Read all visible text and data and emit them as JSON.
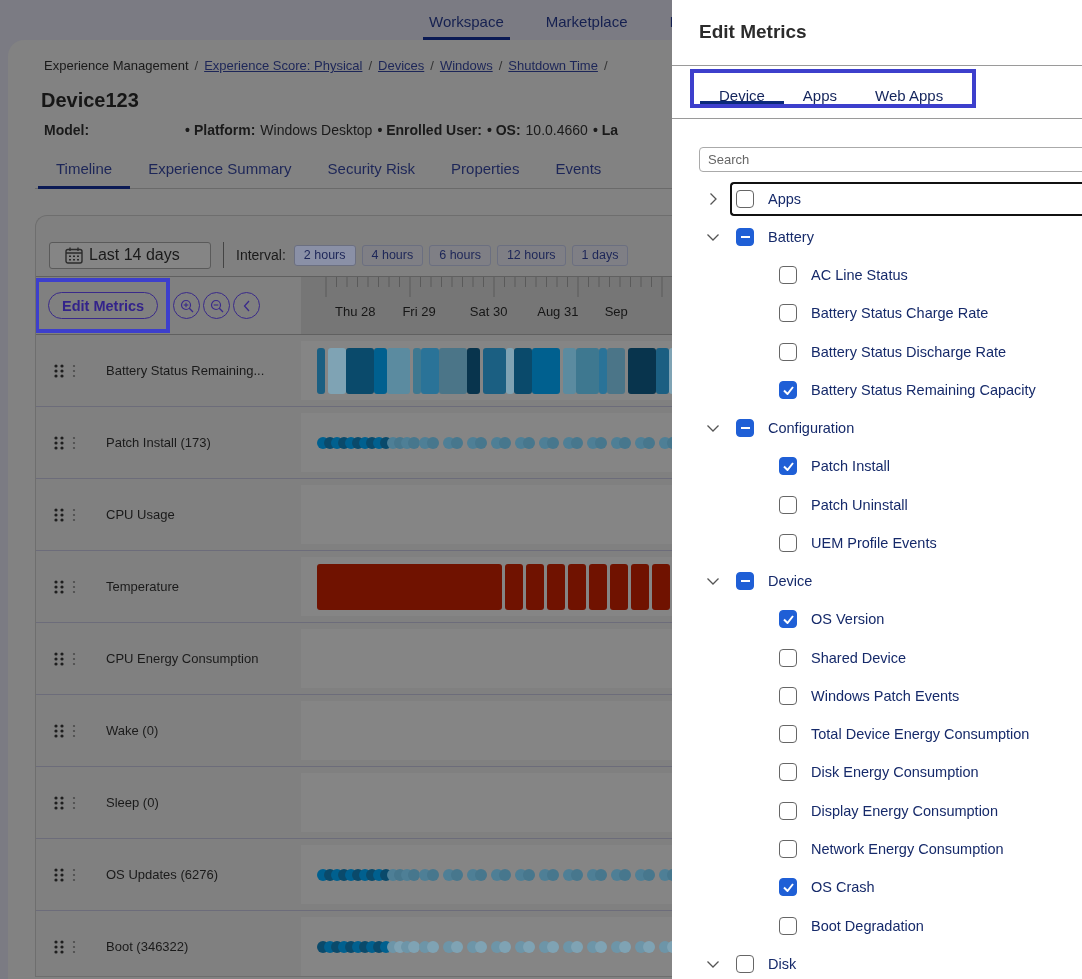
{
  "top_nav": [
    {
      "label": "Workspace",
      "selected": true
    },
    {
      "label": "Marketplace",
      "selected": false
    },
    {
      "label": "I",
      "selected": false
    }
  ],
  "breadcrumb": [
    {
      "label": "Experience Management",
      "link": false
    },
    {
      "label": "Experience Score: Physical",
      "link": true
    },
    {
      "label": "Devices",
      "link": true
    },
    {
      "label": "Windows",
      "link": true
    },
    {
      "label": "Shutdown Time",
      "link": true
    }
  ],
  "breadcrumb_separator": "/",
  "device_name": "Device123",
  "meta": [
    {
      "label": "Model:"
    },
    {
      "label": "• Platform:",
      "value": "Windows Desktop"
    },
    {
      "label": "• Enrolled User:"
    },
    {
      "label": "• OS:",
      "value": "10.0.4660"
    },
    {
      "label": "• La"
    }
  ],
  "tabs": [
    {
      "label": "Timeline",
      "selected": true
    },
    {
      "label": "Experience Summary",
      "selected": false
    },
    {
      "label": "Security Risk",
      "selected": false
    },
    {
      "label": "Properties",
      "selected": false
    },
    {
      "label": "Events",
      "selected": false
    }
  ],
  "date_range": "Last 14 days",
  "interval_label": "Interval:",
  "intervals": [
    {
      "label": "2 hours",
      "selected": true
    },
    {
      "label": "4 hours",
      "selected": false
    },
    {
      "label": "6 hours",
      "selected": false
    },
    {
      "label": "12 hours",
      "selected": false
    },
    {
      "label": "1 days",
      "selected": false
    }
  ],
  "edit_metrics_button": "Edit Metrics",
  "axis_labels": [
    "Thu 28",
    "Fri 29",
    "Sat 30",
    "Aug 31",
    "Sep"
  ],
  "metrics": [
    {
      "name": "Battery Status Remaining...",
      "kind": "blocks"
    },
    {
      "name": "Patch Install (173)",
      "kind": "dots"
    },
    {
      "name": "CPU Usage",
      "kind": "empty"
    },
    {
      "name": "Temperature",
      "kind": "heat"
    },
    {
      "name": "CPU Energy Consumption",
      "kind": "empty"
    },
    {
      "name": "Wake (0)",
      "kind": "empty"
    },
    {
      "name": "Sleep (0)",
      "kind": "empty"
    },
    {
      "name": "OS Updates (6276)",
      "kind": "dots"
    },
    {
      "name": "Boot (346322)",
      "kind": "dots"
    }
  ],
  "panel": {
    "title": "Edit Metrics",
    "tabs": [
      {
        "label": "Device",
        "selected": true
      },
      {
        "label": "Apps",
        "selected": false
      },
      {
        "label": "Web Apps",
        "selected": false
      }
    ],
    "search": {
      "placeholder": "Search"
    },
    "tree": [
      {
        "label": "Apps",
        "expanded": false,
        "indeterminate": false,
        "focused": true
      },
      {
        "label": "Battery",
        "expanded": true,
        "indeterminate": true,
        "focused": false,
        "children": [
          {
            "label": "AC Line Status",
            "checked": false
          },
          {
            "label": "Battery Status Charge Rate",
            "checked": false
          },
          {
            "label": "Battery Status Discharge Rate",
            "checked": false
          },
          {
            "label": "Battery Status Remaining Capacity",
            "checked": true
          }
        ]
      },
      {
        "label": "Configuration",
        "expanded": true,
        "indeterminate": true,
        "focused": false,
        "children": [
          {
            "label": "Patch Install",
            "checked": true
          },
          {
            "label": "Patch Uninstall",
            "checked": false
          },
          {
            "label": "UEM Profile Events",
            "checked": false
          }
        ]
      },
      {
        "label": "Device",
        "expanded": true,
        "indeterminate": true,
        "focused": false,
        "children": [
          {
            "label": "OS Version",
            "checked": true
          },
          {
            "label": "Shared Device",
            "checked": false
          },
          {
            "label": "Windows Patch Events",
            "checked": false
          },
          {
            "label": "Total Device Energy Consumption",
            "checked": false
          },
          {
            "label": "Disk Energy Consumption",
            "checked": false
          },
          {
            "label": "Display Energy Consumption",
            "checked": false
          },
          {
            "label": "Network Energy Consumption",
            "checked": false
          },
          {
            "label": "OS Crash",
            "checked": true
          },
          {
            "label": "Boot Degradation",
            "checked": false
          }
        ]
      },
      {
        "label": "Disk",
        "expanded": true,
        "indeterminate": false,
        "focused": false
      }
    ]
  }
}
